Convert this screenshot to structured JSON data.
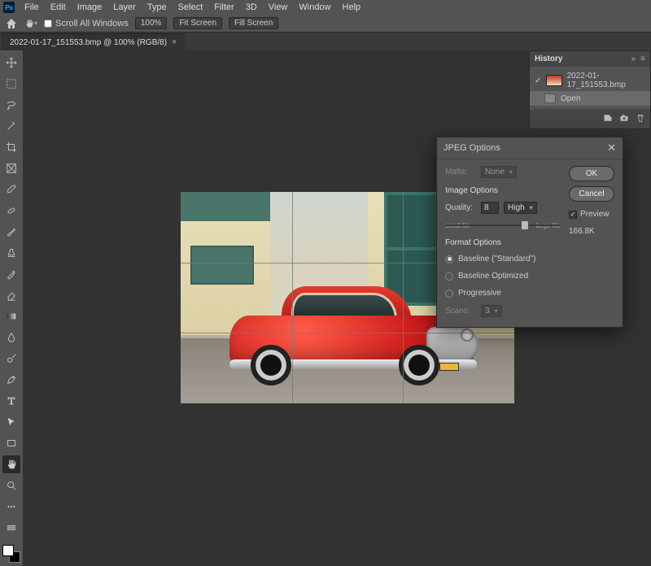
{
  "menu": {
    "items": [
      "File",
      "Edit",
      "Image",
      "Layer",
      "Type",
      "Select",
      "Filter",
      "3D",
      "View",
      "Window",
      "Help"
    ],
    "logo": "Ps"
  },
  "options": {
    "scroll_all": "Scroll All Windows",
    "zoom": "100%",
    "fit": "Fit Screen",
    "fill": "Fill Screen"
  },
  "doc": {
    "tab": "2022-01-17_151553.bmp @ 100% (RGB/8)",
    "close": "×"
  },
  "tools": [
    "move",
    "marquee",
    "lasso",
    "wand",
    "crop",
    "frame",
    "eyedrop",
    "heal",
    "brush",
    "stamp",
    "history-brush",
    "eraser",
    "gradient",
    "blur",
    "dodge",
    "pen",
    "type",
    "path-sel",
    "rectangle",
    "hand",
    "zoom",
    "more",
    "edit-toolbar"
  ],
  "history": {
    "title": "History",
    "snapshot": "2022-01-17_151553.bmp",
    "rows": [
      "Open"
    ]
  },
  "dialog": {
    "title": "JPEG Options",
    "matte_label": "Matte:",
    "matte_value": "None",
    "image_options": "Image Options",
    "quality_label": "Quality:",
    "quality_value": "8",
    "quality_preset": "High",
    "small_file": "small file",
    "large_file": "large file",
    "format_options": "Format Options",
    "opt_baseline_std": "Baseline (\"Standard\")",
    "opt_baseline_opt": "Baseline Optimized",
    "opt_progressive": "Progressive",
    "scans_label": "Scans:",
    "scans_value": "3",
    "ok": "OK",
    "cancel": "Cancel",
    "preview": "Preview",
    "filesize": "166.8K"
  }
}
